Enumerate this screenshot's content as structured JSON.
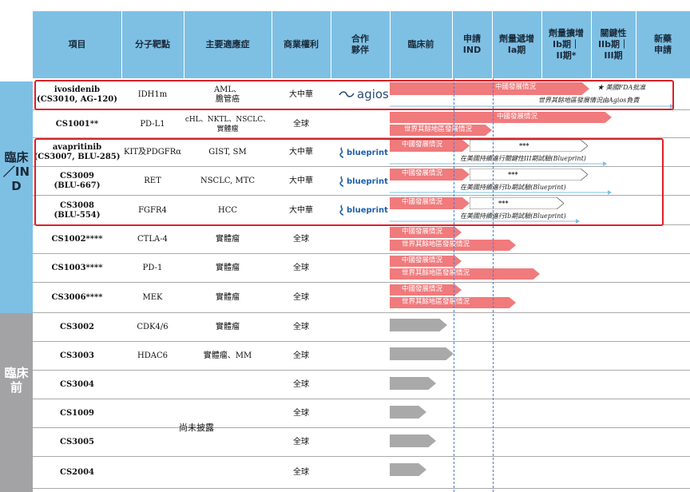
{
  "header": {
    "columns": [
      "項目",
      "分子靶點",
      "主要適應症",
      "商業權利",
      "合作\n夥伴",
      "臨床前",
      "申請\nIND",
      "劑量遞增\nIa期",
      "劑量擴增\nIb期｜\nII期*",
      "關鍵性\nIIb期｜\nIII期",
      "新藥\n申請"
    ]
  },
  "sidebar": {
    "clinical": "臨床／IND",
    "preclinical": "臨床前"
  },
  "rows": [
    {
      "name": "ivosidenib\n(CS3010, AG-120)",
      "target": "IDH1m",
      "indication": "AML、\n膽管癌",
      "rights": "大中華",
      "partner": "agios"
    },
    {
      "name": "CS1001**",
      "target": "PD-L1",
      "indication": "cHL、NKTL、NSCLC、\n實體瘤",
      "rights": "全球",
      "partner": ""
    },
    {
      "name": "avapritinib\n(CS3007, BLU-285)",
      "target": "KIT及PDGFRα",
      "indication": "GIST, SM",
      "rights": "大中華",
      "partner": "blueprint"
    },
    {
      "name": "CS3009\n(BLU-667)",
      "target": "RET",
      "indication": "NSCLC, MTC",
      "rights": "大中華",
      "partner": "blueprint"
    },
    {
      "name": "CS3008\n(BLU-554)",
      "target": "FGFR4",
      "indication": "HCC",
      "rights": "大中華",
      "partner": "blueprint"
    },
    {
      "name": "CS1002****",
      "target": "CTLA-4",
      "indication": "實體瘤",
      "rights": "全球",
      "partner": ""
    },
    {
      "name": "CS1003****",
      "target": "PD-1",
      "indication": "實體瘤",
      "rights": "全球",
      "partner": ""
    },
    {
      "name": "CS3006****",
      "target": "MEK",
      "indication": "實體瘤",
      "rights": "全球",
      "partner": ""
    },
    {
      "name": "CS3002",
      "target": "CDK4/6",
      "indication": "實體瘤",
      "rights": "全球",
      "partner": ""
    },
    {
      "name": "CS3003",
      "target": "HDAC6",
      "indication": "實體瘤、MM",
      "rights": "全球",
      "partner": ""
    },
    {
      "name": "CS3004",
      "target": "",
      "indication": "",
      "rights": "全球",
      "partner": ""
    },
    {
      "name": "CS1009",
      "target": "",
      "indication": "",
      "rights": "全球",
      "partner": ""
    },
    {
      "name": "CS3005",
      "target": "",
      "indication": "",
      "rights": "全球",
      "partner": ""
    },
    {
      "name": "CS2004",
      "target": "",
      "indication": "",
      "rights": "全球",
      "partner": ""
    }
  ],
  "undisclosed": "尚未披露",
  "bar_labels": {
    "china": "中國發展情況",
    "world": "世界其餘地區發展情況",
    "fda": "★ 美國FDA批准",
    "agios_note": "世界其餘地區發展情況由Agios負責",
    "blu285_note": "在美國持續進行關鍵性III期試驗(Blueprint)",
    "blu_ib_note": "在美國持續進行Ib期試驗(Blueprint)",
    "stars": "***"
  },
  "logos": {
    "agios": "agios",
    "blueprint": "blueprint"
  },
  "colors": {
    "header": "#7ec0e4",
    "pink": "#f07a7c",
    "gray_bar": "#a9a9a9",
    "red_box": "#e01e26",
    "clinical_side": "#7ec0e4",
    "preclinical_side": "#a3a3a6"
  }
}
